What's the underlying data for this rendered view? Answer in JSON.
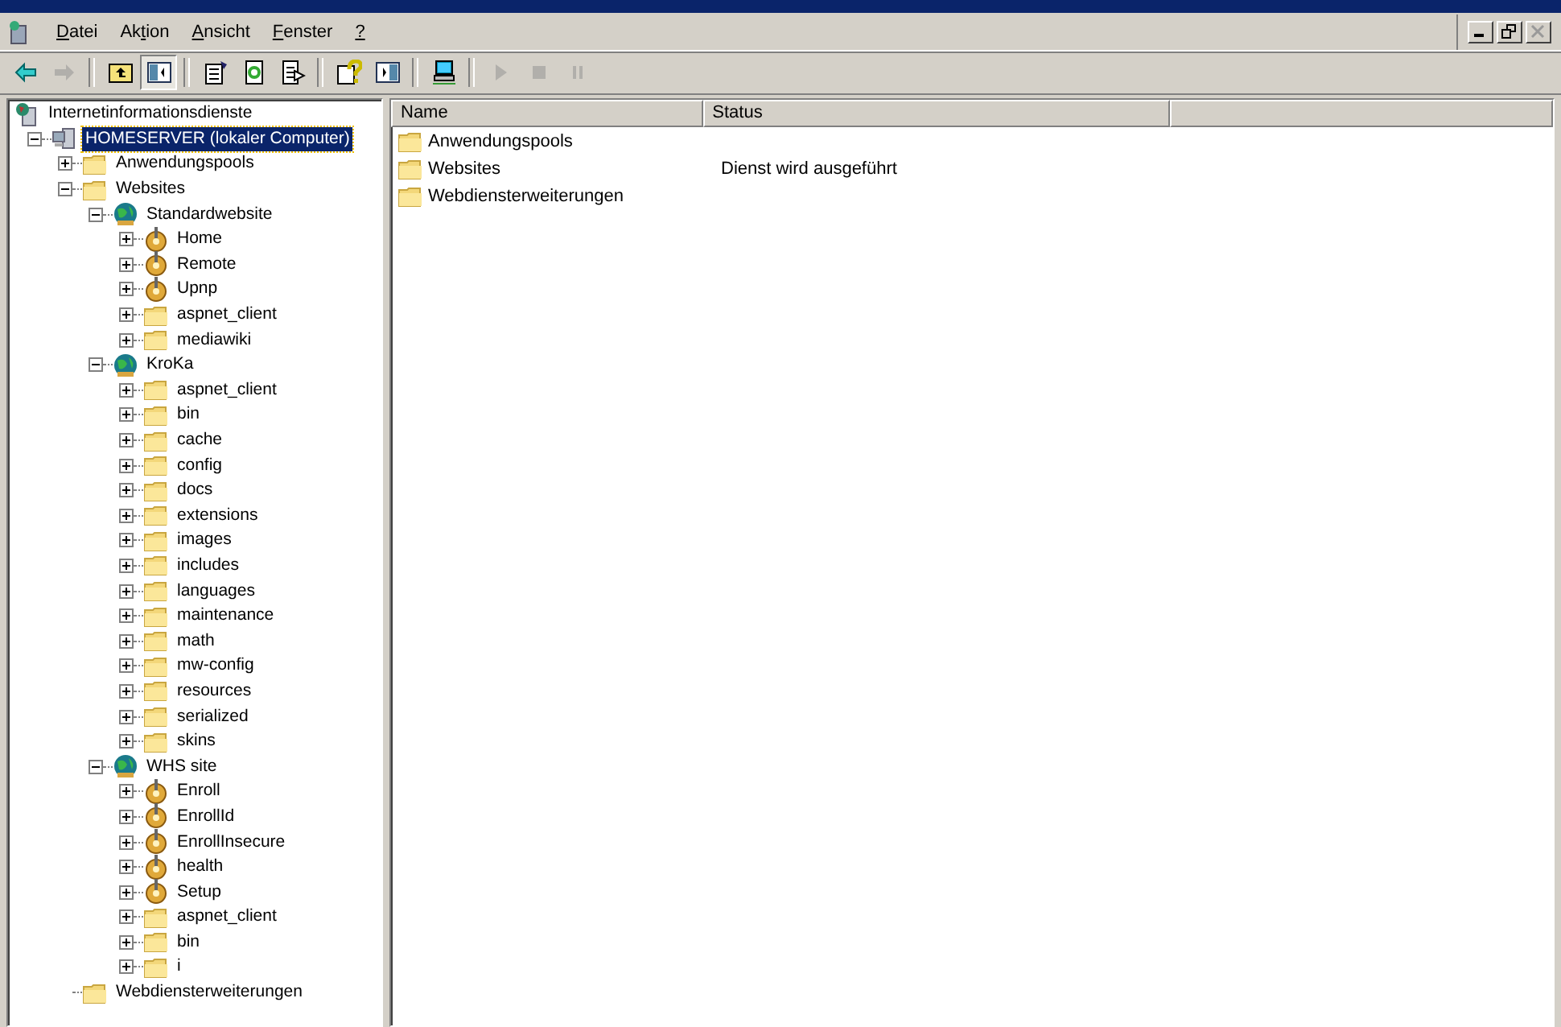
{
  "menu": [
    {
      "label": "Datei"
    },
    {
      "label": "Aktion"
    },
    {
      "label": "Ansicht"
    },
    {
      "label": "Fenster"
    },
    {
      "label": "?"
    }
  ],
  "child_window_buttons": [
    {
      "kind": "minimize",
      "disabled": false
    },
    {
      "kind": "restore",
      "disabled": false
    },
    {
      "kind": "close",
      "disabled": true
    }
  ],
  "toolbar": [
    {
      "kind": "back",
      "disabled": false,
      "pressed": false
    },
    {
      "kind": "forward",
      "disabled": true,
      "pressed": false
    },
    {
      "kind": "sep"
    },
    {
      "kind": "up",
      "disabled": false,
      "pressed": false
    },
    {
      "kind": "tree",
      "disabled": false,
      "pressed": true
    },
    {
      "kind": "sep"
    },
    {
      "kind": "properties",
      "disabled": false,
      "pressed": false
    },
    {
      "kind": "refresh",
      "disabled": false,
      "pressed": false
    },
    {
      "kind": "export",
      "disabled": false,
      "pressed": false
    },
    {
      "kind": "sep"
    },
    {
      "kind": "help",
      "disabled": false,
      "pressed": false
    },
    {
      "kind": "actionpane",
      "disabled": false,
      "pressed": false
    },
    {
      "kind": "sep"
    },
    {
      "kind": "computer",
      "disabled": false,
      "pressed": false
    },
    {
      "kind": "sep"
    },
    {
      "kind": "play",
      "disabled": true,
      "pressed": false
    },
    {
      "kind": "stop",
      "disabled": true,
      "pressed": false
    },
    {
      "kind": "pause",
      "disabled": true,
      "pressed": false
    }
  ],
  "tree": {
    "label": "Internetinformationsdienste",
    "kind": "root",
    "selected": false,
    "children": [
      {
        "label": "HOMESERVER (lokaler Computer)",
        "kind": "server",
        "selected": true,
        "expanded": true,
        "children": [
          {
            "label": "Anwendungspools",
            "kind": "folder",
            "selected": false,
            "expanded": false
          },
          {
            "label": "Websites",
            "kind": "folder",
            "selected": false,
            "expanded": true,
            "children": [
              {
                "label": "Standardwebsite",
                "kind": "site",
                "selected": false,
                "expanded": true,
                "children": [
                  {
                    "label": "Home",
                    "kind": "app",
                    "selected": false,
                    "expanded": false
                  },
                  {
                    "label": "Remote",
                    "kind": "app",
                    "selected": false,
                    "expanded": false
                  },
                  {
                    "label": "Upnp",
                    "kind": "app",
                    "selected": false,
                    "expanded": false
                  },
                  {
                    "label": "aspnet_client",
                    "kind": "folder",
                    "selected": false,
                    "expanded": false
                  },
                  {
                    "label": "mediawiki",
                    "kind": "folder",
                    "selected": false,
                    "expanded": false
                  }
                ]
              },
              {
                "label": "KroKa",
                "kind": "site",
                "selected": false,
                "expanded": true,
                "children": [
                  {
                    "label": "aspnet_client",
                    "kind": "folder",
                    "selected": false,
                    "expanded": false
                  },
                  {
                    "label": "bin",
                    "kind": "folder",
                    "selected": false,
                    "expanded": false
                  },
                  {
                    "label": "cache",
                    "kind": "folder",
                    "selected": false,
                    "expanded": false
                  },
                  {
                    "label": "config",
                    "kind": "folder",
                    "selected": false,
                    "expanded": false
                  },
                  {
                    "label": "docs",
                    "kind": "folder",
                    "selected": false,
                    "expanded": false
                  },
                  {
                    "label": "extensions",
                    "kind": "folder",
                    "selected": false,
                    "expanded": false
                  },
                  {
                    "label": "images",
                    "kind": "folder",
                    "selected": false,
                    "expanded": false
                  },
                  {
                    "label": "includes",
                    "kind": "folder",
                    "selected": false,
                    "expanded": false
                  },
                  {
                    "label": "languages",
                    "kind": "folder",
                    "selected": false,
                    "expanded": false
                  },
                  {
                    "label": "maintenance",
                    "kind": "folder",
                    "selected": false,
                    "expanded": false
                  },
                  {
                    "label": "math",
                    "kind": "folder",
                    "selected": false,
                    "expanded": false
                  },
                  {
                    "label": "mw-config",
                    "kind": "folder",
                    "selected": false,
                    "expanded": false
                  },
                  {
                    "label": "resources",
                    "kind": "folder",
                    "selected": false,
                    "expanded": false
                  },
                  {
                    "label": "serialized",
                    "kind": "folder",
                    "selected": false,
                    "expanded": false
                  },
                  {
                    "label": "skins",
                    "kind": "folder",
                    "selected": false,
                    "expanded": false
                  }
                ]
              },
              {
                "label": "WHS site",
                "kind": "site",
                "selected": false,
                "expanded": true,
                "children": [
                  {
                    "label": "Enroll",
                    "kind": "app",
                    "selected": false,
                    "expanded": false
                  },
                  {
                    "label": "EnrollId",
                    "kind": "app",
                    "selected": false,
                    "expanded": false
                  },
                  {
                    "label": "EnrollInsecure",
                    "kind": "app",
                    "selected": false,
                    "expanded": false
                  },
                  {
                    "label": "health",
                    "kind": "app",
                    "selected": false,
                    "expanded": false
                  },
                  {
                    "label": "Setup",
                    "kind": "app",
                    "selected": false,
                    "expanded": false
                  },
                  {
                    "label": "aspnet_client",
                    "kind": "folder",
                    "selected": false,
                    "expanded": false
                  },
                  {
                    "label": "bin",
                    "kind": "folder",
                    "selected": false,
                    "expanded": false
                  },
                  {
                    "label": "i",
                    "kind": "folder",
                    "selected": false,
                    "expanded": false
                  }
                ]
              }
            ]
          },
          {
            "label": "Webdiensterweiterungen",
            "kind": "folder",
            "selected": false
          }
        ]
      }
    ]
  },
  "list": {
    "columns": [
      "Name",
      "Status"
    ],
    "rows": [
      {
        "name": "Anwendungspools"
      },
      {
        "name": "Websites",
        "status": "Dienst wird ausgeführt"
      },
      {
        "name": "Webdiensterweiterungen"
      }
    ]
  }
}
